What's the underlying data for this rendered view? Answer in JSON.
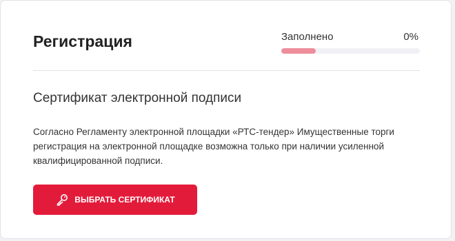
{
  "header": {
    "title": "Регистрация",
    "progress_label": "Заполнено",
    "progress_value": "0%"
  },
  "section": {
    "title": "Сертификат электронной подписи",
    "description": "Согласно Регламенту электронной площадки «РТС-тендер» Имущественные торги регистрация на электронной площадке возможна только при наличии усиленной квалифицированной подписи."
  },
  "actions": {
    "select_certificate_label": "ВЫБРАТЬ СЕРТИФИКАТ",
    "select_certificate_icon": "key-icon"
  },
  "colors": {
    "accent": "#e31b3a",
    "progress_fill": "#ee8e9c",
    "progress_track": "#f1f1f5"
  }
}
